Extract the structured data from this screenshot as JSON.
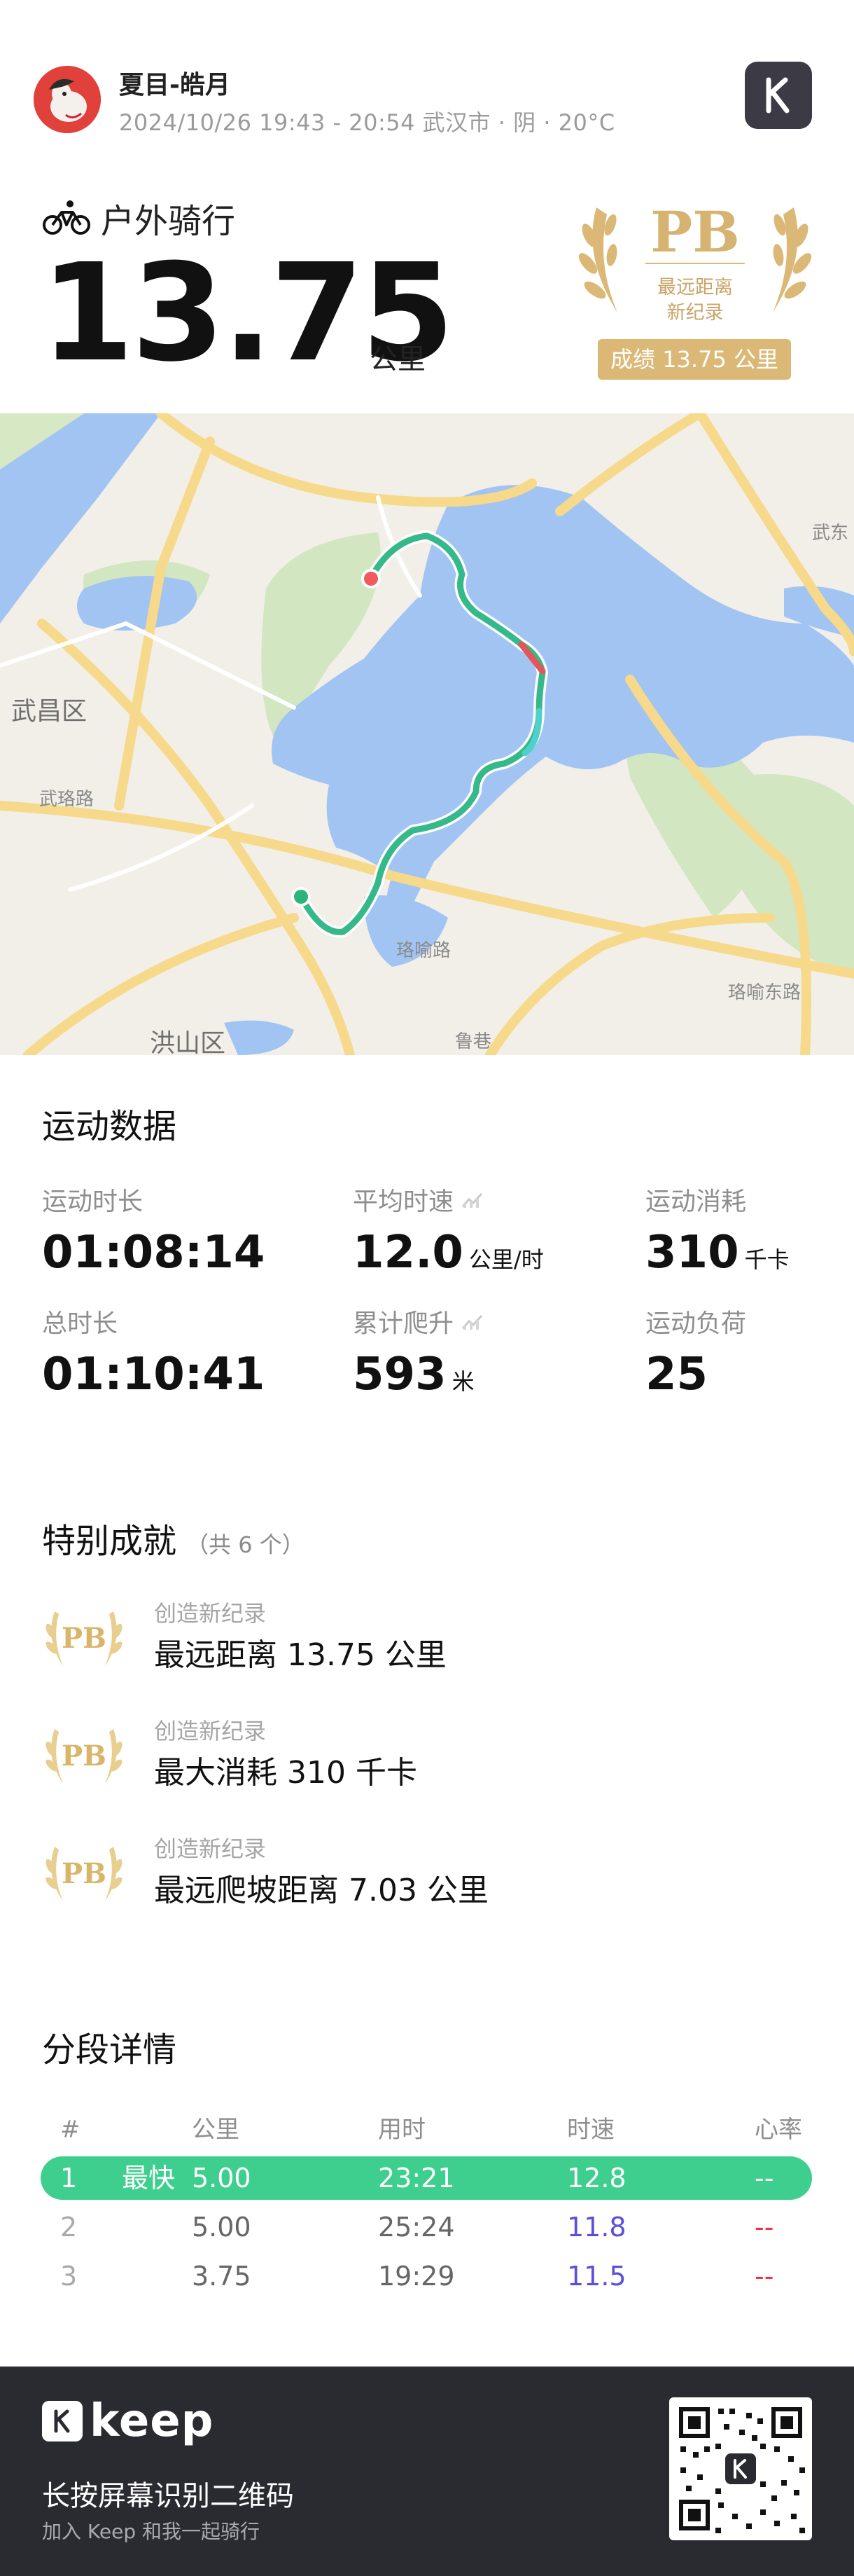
{
  "user": {
    "name": "夏目-皓月",
    "info": "2024/10/26 19:43 - 20:54 武汉市 · 阴 · 20°C"
  },
  "activity": {
    "type": "户外骑行",
    "distance": "13.75",
    "distance_unit": "公里"
  },
  "pb_badge": {
    "text": "PB",
    "line1": "最远距离",
    "line2": "新纪录",
    "result": "成绩 13.75 公里"
  },
  "map": {
    "labels": {
      "wuchang": "武昌区",
      "hongshan": "洪山区",
      "wudong": "武东",
      "wuluo": "武珞路",
      "luoyu": "珞喻路",
      "luoyu_east": "珞喻东路",
      "luxiang": "鲁巷"
    }
  },
  "stats": {
    "title": "运动数据",
    "items": [
      {
        "label": "运动时长",
        "value": "01:08:14",
        "unit": ""
      },
      {
        "label": "平均时速",
        "value": "12.0",
        "unit": "公里/时"
      },
      {
        "label": "运动消耗",
        "value": "310",
        "unit": "千卡"
      },
      {
        "label": "总时长",
        "value": "01:10:41",
        "unit": ""
      },
      {
        "label": "累计爬升",
        "value": "593",
        "unit": "米"
      },
      {
        "label": "运动负荷",
        "value": "25",
        "unit": ""
      }
    ]
  },
  "achievements": {
    "title": "特别成就",
    "count": "（共 6 个）",
    "items": [
      {
        "type": "创造新纪录",
        "title": "最远距离 13.75 公里"
      },
      {
        "type": "创造新纪录",
        "title": "最大消耗 310 千卡"
      },
      {
        "type": "创造新纪录",
        "title": "最远爬坡距离 7.03 公里"
      }
    ]
  },
  "segments": {
    "title": "分段详情",
    "headers": {
      "num": "#",
      "km": "公里",
      "time": "用时",
      "speed": "时速",
      "hr": "心率"
    },
    "rows": [
      {
        "num": "1",
        "tag": "最快",
        "km": "5.00",
        "time": "23:21",
        "speed": "12.8",
        "hr": "--"
      },
      {
        "num": "2",
        "tag": "",
        "km": "5.00",
        "time": "25:24",
        "speed": "11.8",
        "hr": "--"
      },
      {
        "num": "3",
        "tag": "",
        "km": "3.75",
        "time": "19:29",
        "speed": "11.5",
        "hr": "--"
      }
    ]
  },
  "footer": {
    "brand": "keep",
    "line1": "长按屏幕识别二维码",
    "line2": "加入 Keep 和我一起骑行"
  },
  "colors": {
    "accent_green": "#3ecf8e",
    "gold": "#d7b372",
    "purple": "#5b4fd9",
    "red": "#f5333f",
    "footer_bg": "#2a2a31"
  }
}
